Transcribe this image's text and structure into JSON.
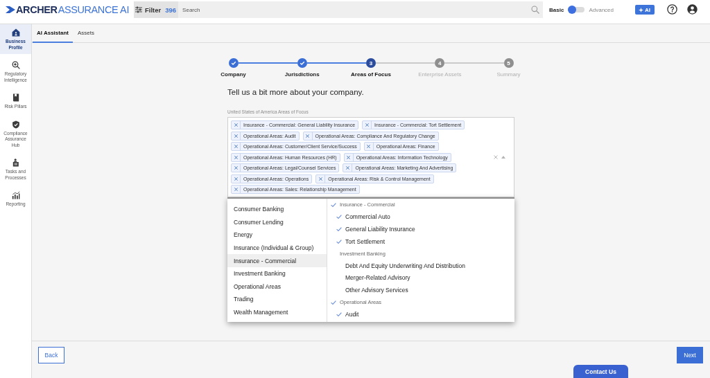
{
  "header": {
    "logo": {
      "name": "ARCHER",
      "suffix": "ASSURANCE AI"
    },
    "filter": {
      "label": "Filter",
      "count": "396"
    },
    "search": {
      "placeholder": "Search"
    },
    "mode_toggle": {
      "left_label": "Basic",
      "right_label": "Advanced",
      "on": false
    },
    "ai_button": {
      "label": "AI"
    }
  },
  "sidebar": {
    "items": [
      {
        "label": "Business Profile",
        "selected": true
      },
      {
        "label": "Regulatory Intelligence",
        "selected": false
      },
      {
        "label": "Risk Pillars",
        "selected": false
      },
      {
        "label": "Compliance Assurance Hub",
        "selected": false
      },
      {
        "label": "Tasks and Processes",
        "selected": false
      },
      {
        "label": "Reporting",
        "selected": false
      }
    ]
  },
  "tabs": [
    {
      "label": "AI Assistant",
      "selected": true
    },
    {
      "label": "Assets",
      "selected": false
    }
  ],
  "stepper": {
    "steps": [
      {
        "label": "Company",
        "completed": true,
        "selected": false
      },
      {
        "label": "Jurisdictions",
        "completed": true,
        "selected": false
      },
      {
        "label": "Areas of Focus",
        "completed": false,
        "selected": true,
        "number": "3"
      },
      {
        "label": "Enterprise Assets",
        "completed": false,
        "selected": false,
        "number": "4"
      },
      {
        "label": "Summary",
        "completed": false,
        "selected": false,
        "number": "5"
      }
    ]
  },
  "form": {
    "heading": "Tell us a bit more about your company.",
    "focus_field": {
      "label": "United States of America Areas of Focus",
      "expanded": true,
      "tags": [
        "Insurance - Commercial: General Liability Insurance",
        "Insurance - Commercial: Tort Settlement",
        "Operational Areas: Audit",
        "Operational Areas: Compliance And Regulatory Change",
        "Operational Areas: Customer/Client Service/Success",
        "Operational Areas: Finance",
        "Operational Areas: Human Resources (HR)",
        "Operational Areas: Information Technology",
        "Operational Areas: Legal/Counsel Services",
        "Operational Areas: Marketing And Advertising",
        "Operational Areas: Operations",
        "Operational Areas: Risk & Control Management",
        "Operational Areas: Sales: Relationship Management"
      ]
    },
    "dropdown": {
      "categories": [
        {
          "label": "Consumer Banking",
          "selected": false
        },
        {
          "label": "Consumer Lending",
          "selected": false
        },
        {
          "label": "Energy",
          "selected": false
        },
        {
          "label": "Insurance (Individual & Group)",
          "selected": false
        },
        {
          "label": "Insurance - Commercial",
          "selected": true
        },
        {
          "label": "Investment Banking",
          "selected": false
        },
        {
          "label": "Operational Areas",
          "selected": false
        },
        {
          "label": "Trading",
          "selected": false
        },
        {
          "label": "Wealth Management",
          "selected": false
        }
      ],
      "options": [
        {
          "kind": "group",
          "label": "Insurance - Commercial",
          "checked": true
        },
        {
          "kind": "option",
          "label": "Commercial Auto",
          "checked": true
        },
        {
          "kind": "option",
          "label": "General Liability Insurance",
          "checked": true
        },
        {
          "kind": "option",
          "label": "Tort Settlement",
          "checked": true
        },
        {
          "kind": "group",
          "label": "Investment Banking",
          "checked": false
        },
        {
          "kind": "option",
          "label": "Debt And Equity Underwriting And Distribution",
          "checked": false
        },
        {
          "kind": "option",
          "label": "Merger-Related Advisory",
          "checked": false
        },
        {
          "kind": "option",
          "label": "Other Advisory Services",
          "checked": false
        },
        {
          "kind": "group",
          "label": "Operational Areas",
          "checked": true
        },
        {
          "kind": "option",
          "label": "Audit",
          "checked": true
        }
      ]
    }
  },
  "footer": {
    "back_button": "Back",
    "next_button": "Next",
    "contact_button": "Contact Us"
  }
}
